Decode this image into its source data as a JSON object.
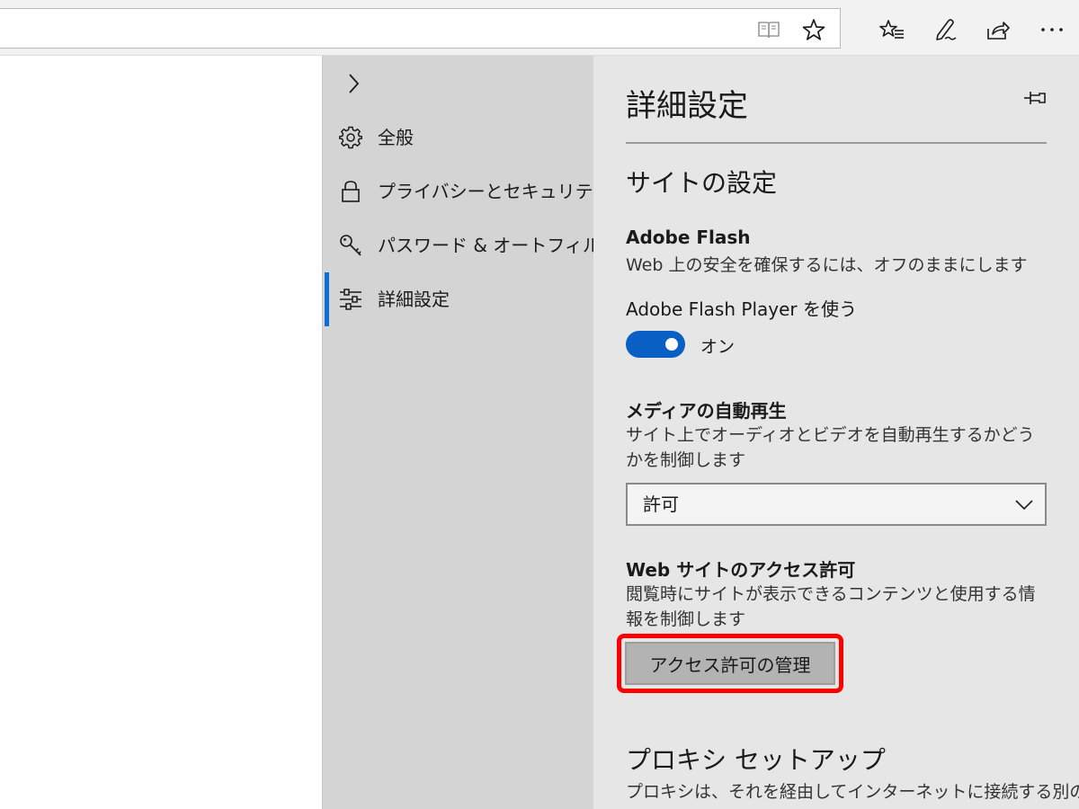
{
  "toolbar": {
    "icons": [
      "reading-view-icon",
      "add-favorite-star-icon",
      "favorites-hub-icon",
      "web-note-pen-icon",
      "share-icon",
      "more-icon"
    ]
  },
  "nav": {
    "items": [
      {
        "label": "全般",
        "icon": "gear-icon"
      },
      {
        "label": "プライバシーとセキュリティ",
        "icon": "lock-icon"
      },
      {
        "label": "パスワード & オートフィル",
        "icon": "key-icon"
      },
      {
        "label": "詳細設定",
        "icon": "sliders-icon",
        "active": true
      }
    ]
  },
  "panel": {
    "title": "詳細設定",
    "site_settings_title": "サイトの設定",
    "flash": {
      "title": "Adobe Flash",
      "desc": "Web 上の安全を確保するには、オフのままにします",
      "toggle_label": "Adobe Flash Player を使う",
      "toggle_state": "オン"
    },
    "media": {
      "title": "メディアの自動再生",
      "desc": "サイト上でオーディオとビデオを自動再生するかどうかを制御します",
      "selected": "許可"
    },
    "permissions": {
      "title": "Web サイトのアクセス許可",
      "desc": "閲覧時にサイトが表示できるコンテンツと使用する情報を制御します",
      "button": "アクセス許可の管理"
    },
    "proxy": {
      "title": "プロキシ セットアップ",
      "desc": "プロキシは、それを経由してインターネットに接続する別の"
    }
  },
  "colors": {
    "accent": "#0a5fc4",
    "nav_bg": "#d4d4d4",
    "panel_bg": "#e6e6e6",
    "highlight": "#ff0000"
  }
}
